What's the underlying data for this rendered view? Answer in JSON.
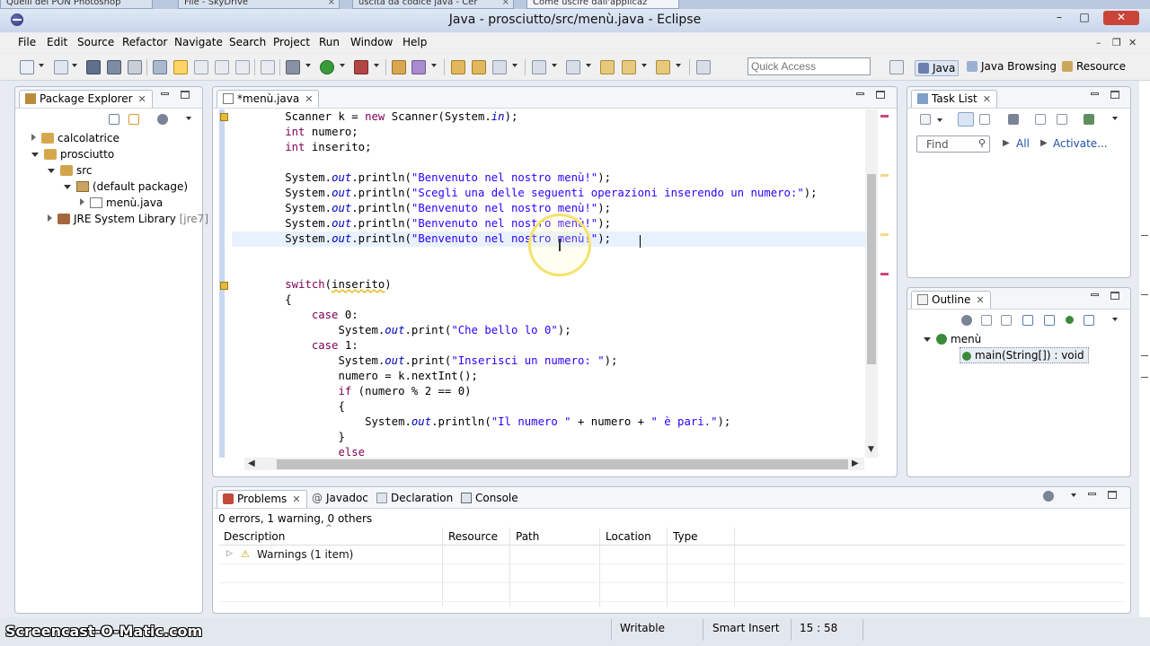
{
  "browser_tabs": [
    {
      "label": "Quelli del PON Photoshop"
    },
    {
      "label": "File - SkyDrive"
    },
    {
      "label": "uscita da codice java - Cer"
    },
    {
      "label": "Come uscire dall'applicaz"
    }
  ],
  "window": {
    "title": "Java - prosciutto/src/menù.java - Eclipse",
    "min": "–",
    "max": "□",
    "close": "✕"
  },
  "menu": [
    "File",
    "Edit",
    "Source",
    "Refactor",
    "Navigate",
    "Search",
    "Project",
    "Run",
    "Window",
    "Help"
  ],
  "toolbar": {
    "quick_access_placeholder": "Quick Access",
    "perspectives": [
      {
        "label": "Java",
        "active": true
      },
      {
        "label": "Java Browsing",
        "active": false
      },
      {
        "label": "Resource",
        "active": false
      }
    ]
  },
  "package_explorer": {
    "title": "Package Explorer",
    "tree": [
      {
        "label": "calcolatrice",
        "state": "closed"
      },
      {
        "label": "prosciutto",
        "state": "open"
      },
      {
        "label": "src",
        "state": "open"
      },
      {
        "label": "(default package)",
        "state": "open"
      },
      {
        "label": "menù.java",
        "state": "closed"
      },
      {
        "label": "JRE System Library",
        "suffix": "[jre7]",
        "state": "closed"
      }
    ]
  },
  "editor": {
    "tab_label": "*menù.java",
    "lines": [
      "        Scanner k = new Scanner(System.in);",
      "        int numero;",
      "        int inserito;",
      "",
      "        System.out.println(\"Benvenuto nel nostro menù!\");",
      "        System.out.println(\"Scegli una delle seguenti operazioni inserendo un numero:\");",
      "        System.out.println(\"Benvenuto nel nostro menù!\");",
      "        System.out.println(\"Benvenuto nel nostro menù!\");",
      "        System.out.println(\"Benvenuto nel nostro menù!\");",
      "",
      "",
      "        switch(inserito)",
      "        {",
      "            case 0:",
      "                System.out.print(\"Che bello lo 0\");",
      "            case 1:",
      "                System.out.print(\"Inserisci un numero: \");",
      "                numero = k.nextInt();",
      "                if (numero % 2 == 0)",
      "                {",
      "                    System.out.println(\"Il numero \" + numero + \" è pari.\");",
      "                }",
      "                else"
    ]
  },
  "task_list": {
    "title": "Task List",
    "find_placeholder": "Find",
    "all_label": "All",
    "activate_label": "Activate..."
  },
  "outline": {
    "title": "Outline",
    "class_name": "menù",
    "method": "main(String[]) : void"
  },
  "bottom_panel": {
    "tabs": [
      "Problems",
      "Javadoc",
      "Declaration",
      "Console"
    ],
    "summary": "0 errors, 1 warning, 0 others",
    "columns": [
      "Description",
      "Resource",
      "Path",
      "Location",
      "Type"
    ],
    "rows": [
      {
        "description": "Warnings (1 item)"
      }
    ]
  },
  "status": {
    "writable": "Writable",
    "insert_mode": "Smart Insert",
    "position": "15 : 58"
  },
  "watermark": "Screencast-O-Matic.com"
}
